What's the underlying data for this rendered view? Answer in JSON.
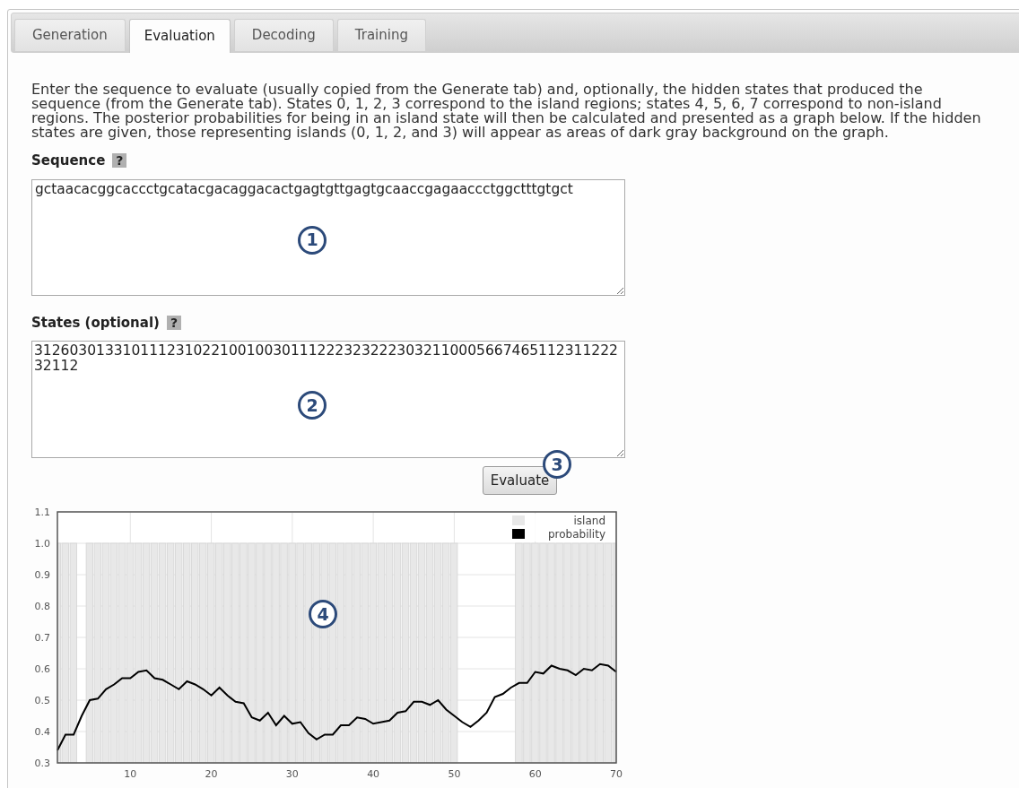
{
  "tabs": [
    {
      "label": "Generation",
      "selected": false
    },
    {
      "label": "Evaluation",
      "selected": true
    },
    {
      "label": "Decoding",
      "selected": false
    },
    {
      "label": "Training",
      "selected": false
    }
  ],
  "description": "Enter the sequence to evaluate (usually copied from the Generate tab) and, optionally, the hidden states that produced the sequence (from the Generate tab). States 0, 1, 2, 3 correspond to the island regions; states 4, 5, 6, 7 correspond to non-island regions. The posterior probabilities for being in an island state will then be calculated and presented as a graph below. If the hidden states are given, those representing islands (0, 1, 2, and 3) will appear as areas of dark gray background on the graph.",
  "sequence": {
    "label": "Sequence",
    "help": "?",
    "value": "gctaacacggcaccctgcatacgacaggacactgagtgttgagtgcaaccgagaaccctggctttgtgct",
    "callout": "1"
  },
  "states": {
    "label": "States (optional)",
    "help": "?",
    "value": "31260301331011123102210010030111222323222303211000566746511231122232112",
    "callout": "2"
  },
  "evaluate_button": {
    "label": "Evaluate",
    "callout": "3"
  },
  "chart_callout": "4",
  "chart_data": {
    "type": "bar",
    "x": [
      1,
      2,
      3,
      4,
      5,
      6,
      7,
      8,
      9,
      10,
      11,
      12,
      13,
      14,
      15,
      16,
      17,
      18,
      19,
      20,
      21,
      22,
      23,
      24,
      25,
      26,
      27,
      28,
      29,
      30,
      31,
      32,
      33,
      34,
      35,
      36,
      37,
      38,
      39,
      40,
      41,
      42,
      43,
      44,
      45,
      46,
      47,
      48,
      49,
      50,
      51,
      52,
      53,
      54,
      55,
      56,
      57,
      58,
      59,
      60,
      61,
      62,
      63,
      64,
      65,
      66,
      67,
      68,
      69,
      70
    ],
    "series": [
      {
        "name": "island",
        "type": "bar",
        "color": "#e8e8e8",
        "values": [
          1,
          1,
          1,
          null,
          1,
          1,
          1,
          1,
          1,
          1,
          1,
          1,
          1,
          1,
          1,
          1,
          1,
          1,
          1,
          1,
          1,
          1,
          1,
          1,
          1,
          1,
          1,
          1,
          1,
          1,
          1,
          1,
          1,
          1,
          1,
          1,
          1,
          1,
          1,
          1,
          1,
          1,
          1,
          1,
          1,
          1,
          1,
          1,
          1,
          1,
          null,
          null,
          null,
          null,
          null,
          null,
          null,
          1,
          1,
          1,
          1,
          1,
          1,
          1,
          1,
          1,
          1,
          1,
          1,
          1
        ]
      },
      {
        "name": "probability",
        "type": "line",
        "color": "#000000",
        "values": [
          0.34,
          0.39,
          0.39,
          0.45,
          0.5,
          0.505,
          0.535,
          0.55,
          0.57,
          0.57,
          0.59,
          0.595,
          0.57,
          0.565,
          0.55,
          0.535,
          0.56,
          0.55,
          0.535,
          0.515,
          0.54,
          0.515,
          0.495,
          0.49,
          0.445,
          0.435,
          0.46,
          0.42,
          0.45,
          0.425,
          0.43,
          0.395,
          0.375,
          0.39,
          0.39,
          0.42,
          0.42,
          0.445,
          0.44,
          0.425,
          0.43,
          0.435,
          0.46,
          0.465,
          0.495,
          0.495,
          0.485,
          0.5,
          0.47,
          0.45,
          0.43,
          0.415,
          0.435,
          0.46,
          0.51,
          0.52,
          0.54,
          0.555,
          0.555,
          0.59,
          0.585,
          0.61,
          0.6,
          0.595,
          0.58,
          0.6,
          0.595,
          0.615,
          0.61,
          0.59
        ]
      }
    ],
    "grid": true,
    "xlim": [
      1,
      70
    ],
    "ylim": [
      0.3,
      1.1
    ],
    "xticks": [
      10,
      20,
      30,
      40,
      50,
      60,
      70
    ],
    "yticks": [
      {
        "value": 0.3,
        "label": "0.3"
      },
      {
        "value": 0.4,
        "label": "0.4"
      },
      {
        "value": 0.5,
        "label": "0.5"
      },
      {
        "value": 0.6,
        "label": "0.6"
      },
      {
        "value": 0.7,
        "label": "0.7"
      },
      {
        "value": 0.8,
        "label": "0.8"
      },
      {
        "value": 0.9,
        "label": "0.9"
      },
      {
        "value": 1.0,
        "label": "1.0"
      },
      {
        "value": 1.1,
        "label": "1.1"
      }
    ]
  }
}
